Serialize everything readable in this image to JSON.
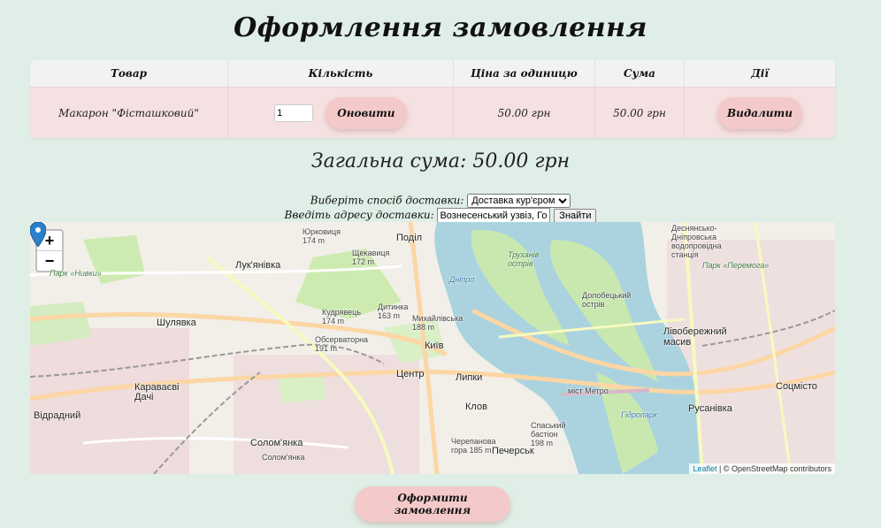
{
  "page": {
    "title": "Оформлення замовлення"
  },
  "cart": {
    "headers": [
      "Товар",
      "Кількість",
      "Ціна за одиницю",
      "Сума",
      "Дії"
    ],
    "items": [
      {
        "name": "Макарон \"Фісташковий\"",
        "quantity": "1",
        "update_label": "Оновити",
        "unit_price": "50.00 грн",
        "sum": "50.00 грн",
        "delete_label": "Видалити"
      }
    ]
  },
  "total": {
    "text": "Загальна сума: 50.00 грн"
  },
  "delivery": {
    "method_label": "Виберіть спосіб доставки:",
    "method_selected": "Доставка кур'єром",
    "address_label": "Введіть адресу доставки:",
    "address_value": "Вознесенський узвіз, Город",
    "find_label": "Знайти"
  },
  "map": {
    "zoom_in": "+",
    "zoom_out": "−",
    "attribution_leaflet": "Leaflet",
    "attribution_rest": " | © OpenStreetMap contributors",
    "labels": [
      {
        "text": "Київ",
        "cls": "big"
      },
      {
        "text": "Поділ",
        "cls": "big"
      },
      {
        "text": "Лук'янівка",
        "cls": "big"
      },
      {
        "text": "Шулявка",
        "cls": "big"
      },
      {
        "text": "Караваєві Дачі",
        "cls": "big"
      },
      {
        "text": "Відрадний",
        "cls": "big"
      },
      {
        "text": "Солом'янка",
        "cls": "big"
      },
      {
        "text": "Центр",
        "cls": "big"
      },
      {
        "text": "Липки",
        "cls": "big"
      },
      {
        "text": "Клов",
        "cls": "big"
      },
      {
        "text": "Печерськ",
        "cls": "big"
      },
      {
        "text": "Лівобережний масив",
        "cls": "big"
      },
      {
        "text": "Русанівка",
        "cls": "big"
      },
      {
        "text": "Соцмісто",
        "cls": "big"
      },
      {
        "text": "Гідропарк",
        "cls": "water"
      },
      {
        "text": "Труханів острів",
        "cls": "green"
      },
      {
        "text": "Долобецький острів",
        "cls": ""
      },
      {
        "text": "Парк «Нивки»",
        "cls": "green"
      },
      {
        "text": "Обсерваторна 191 m",
        "cls": ""
      },
      {
        "text": "Дитинка 163 m",
        "cls": ""
      },
      {
        "text": "Кудрявець 174 m",
        "cls": ""
      },
      {
        "text": "Щекавиця 172 m",
        "cls": ""
      },
      {
        "text": "Юрковиця 174 m",
        "cls": ""
      },
      {
        "text": "Михайлівська 188 m",
        "cls": ""
      },
      {
        "text": "Спаський бастіон 198 m",
        "cls": ""
      },
      {
        "text": "Черепанова гора 185 m",
        "cls": ""
      },
      {
        "text": "міст Метро",
        "cls": ""
      },
      {
        "text": "Деснянсько-Дніпровська водопровідна станція",
        "cls": ""
      },
      {
        "text": "Парк «Перемога»",
        "cls": "green"
      },
      {
        "text": "Дніпро",
        "cls": "water"
      },
      {
        "text": "Солом'янка",
        "cls": ""
      }
    ]
  },
  "order": {
    "button_label": "Оформити замовлення"
  }
}
